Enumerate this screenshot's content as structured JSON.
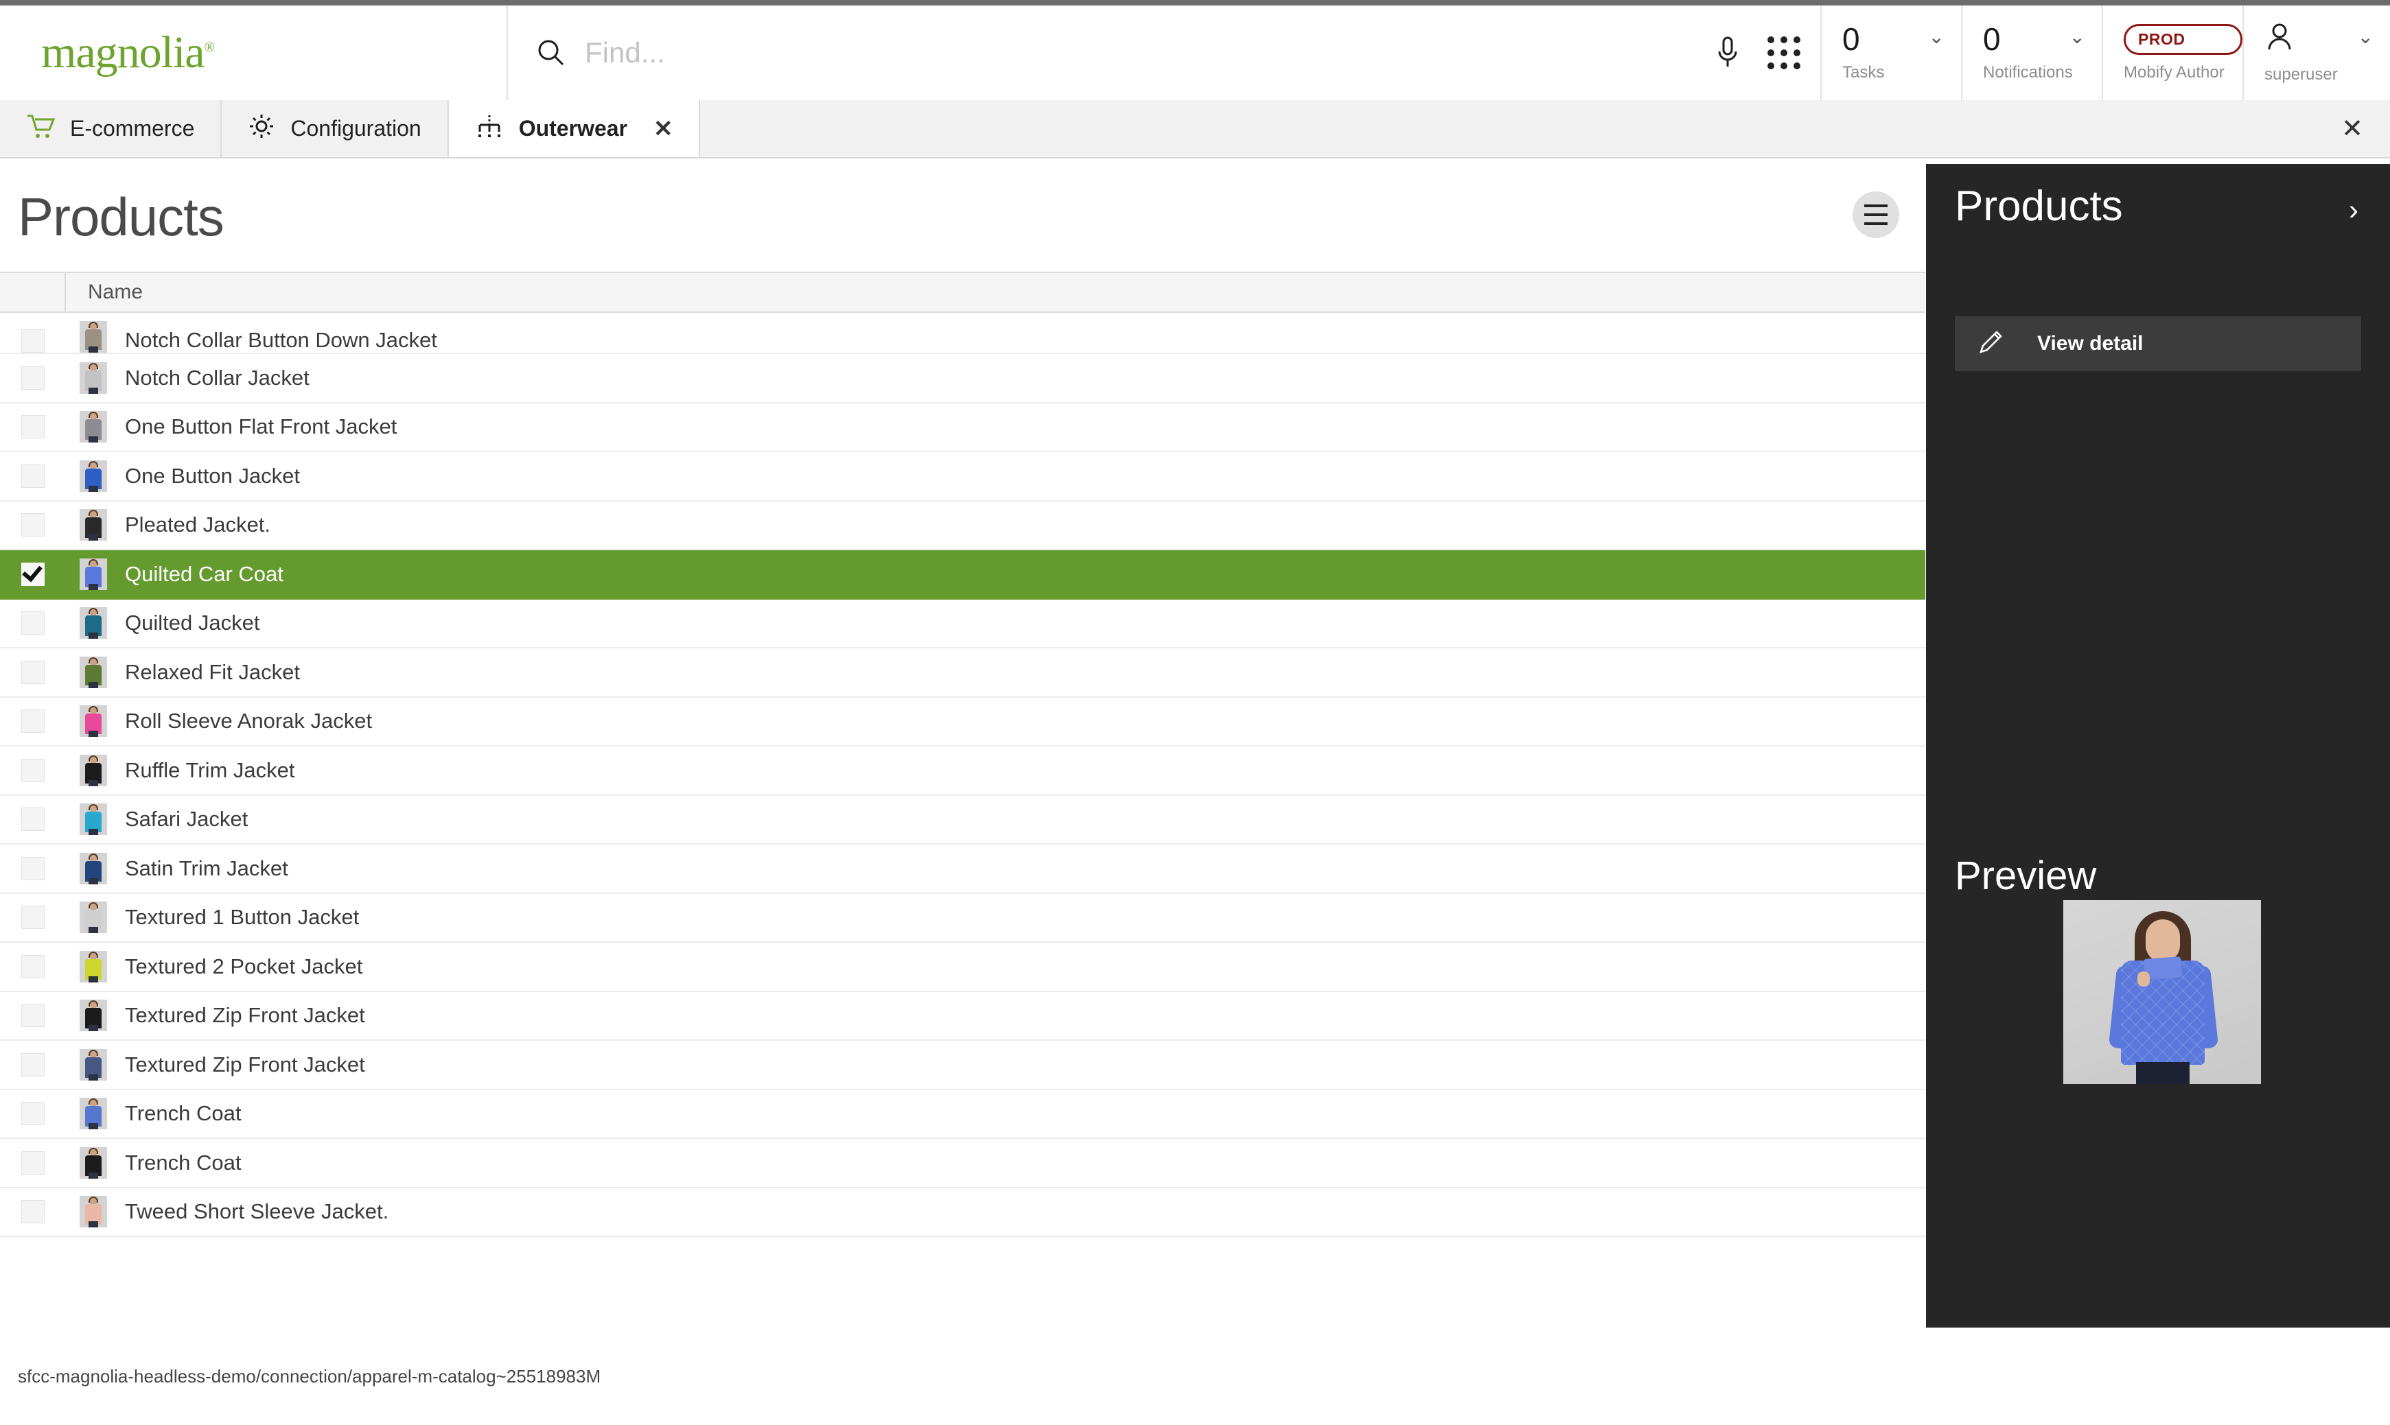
{
  "header": {
    "logo_text": "magnolia",
    "logo_registered": "®",
    "logo_color": "#6ea32e",
    "search": {
      "placeholder": "Find...",
      "value": "",
      "icon": "search-icon"
    },
    "mic_icon": "microphone-icon",
    "apps_icon": "apps-grid-icon",
    "tasks": {
      "count": "0",
      "label": "Tasks"
    },
    "notifications": {
      "count": "0",
      "label": "Notifications"
    },
    "instance": {
      "badge": "PROD",
      "label": "Mobify Author",
      "badge_color": "#8e1616"
    },
    "user": {
      "name": "superuser",
      "icon": "user-avatar-icon"
    }
  },
  "tabs": [
    {
      "label": "E-commerce",
      "icon": "shopping-cart-icon",
      "active": false,
      "closable": false
    },
    {
      "label": "Configuration",
      "icon": "gear-icon",
      "active": false,
      "closable": false
    },
    {
      "label": "Outerwear",
      "icon": "tree-hierarchy-icon",
      "active": true,
      "closable": true,
      "close_glyph": "✕"
    }
  ],
  "tabbar": {
    "close_all_glyph": "✕"
  },
  "main": {
    "page_title": "Products",
    "view_switch_icon": "hamburger-menu-icon",
    "columns": [
      "Name"
    ],
    "rows": [
      {
        "name": "Notch Collar Button Down Jacket",
        "selected": false,
        "checked": false,
        "thumb_color": "#9a9184",
        "partial": true
      },
      {
        "name": "Notch Collar Jacket",
        "selected": false,
        "checked": false,
        "thumb_color": "#c3c3c3"
      },
      {
        "name": "One Button Flat Front Jacket",
        "selected": false,
        "checked": false,
        "thumb_color": "#8c8c92"
      },
      {
        "name": "One Button Jacket",
        "selected": false,
        "checked": false,
        "thumb_color": "#2f5fc4"
      },
      {
        "name": "Pleated Jacket.",
        "selected": false,
        "checked": false,
        "thumb_color": "#2a2a2a"
      },
      {
        "name": "Quilted Car Coat",
        "selected": true,
        "checked": true,
        "thumb_color": "#5b79dd"
      },
      {
        "name": "Quilted Jacket",
        "selected": false,
        "checked": false,
        "thumb_color": "#1d6b86"
      },
      {
        "name": "Relaxed Fit Jacket",
        "selected": false,
        "checked": false,
        "thumb_color": "#5e7a33"
      },
      {
        "name": "Roll Sleeve Anorak Jacket",
        "selected": false,
        "checked": false,
        "thumb_color": "#e8499b"
      },
      {
        "name": "Ruffle Trim Jacket",
        "selected": false,
        "checked": false,
        "thumb_color": "#1c1c1c"
      },
      {
        "name": "Safari Jacket",
        "selected": false,
        "checked": false,
        "thumb_color": "#29a8cf"
      },
      {
        "name": "Satin Trim Jacket",
        "selected": false,
        "checked": false,
        "thumb_color": "#23457e"
      },
      {
        "name": "Textured 1 Button Jacket",
        "selected": false,
        "checked": false,
        "thumb_color": "#cfcfcf"
      },
      {
        "name": "Textured 2 Pocket Jacket",
        "selected": false,
        "checked": false,
        "thumb_color": "#cbd62f"
      },
      {
        "name": "Textured Zip Front Jacket",
        "selected": false,
        "checked": false,
        "thumb_color": "#1b1b1b"
      },
      {
        "name": "Textured Zip Front Jacket",
        "selected": false,
        "checked": false,
        "thumb_color": "#4a5682"
      },
      {
        "name": "Trench Coat",
        "selected": false,
        "checked": false,
        "thumb_color": "#5577cf"
      },
      {
        "name": "Trench Coat",
        "selected": false,
        "checked": false,
        "thumb_color": "#1c1c1c"
      },
      {
        "name": "Tweed Short Sleeve Jacket.",
        "selected": false,
        "checked": false,
        "thumb_color": "#e9b9a6"
      }
    ]
  },
  "right_panel": {
    "title": "Products",
    "expand_glyph": "›",
    "actions": [
      {
        "label": "View detail",
        "icon": "pencil-edit-icon"
      }
    ],
    "preview": {
      "title": "Preview",
      "image_alt": "Woman wearing blue quilted car coat",
      "background_color": "#262626"
    }
  },
  "status_bar": {
    "path": "sfcc-magnolia-headless-demo/connection/apparel-m-catalog~25518983M"
  }
}
